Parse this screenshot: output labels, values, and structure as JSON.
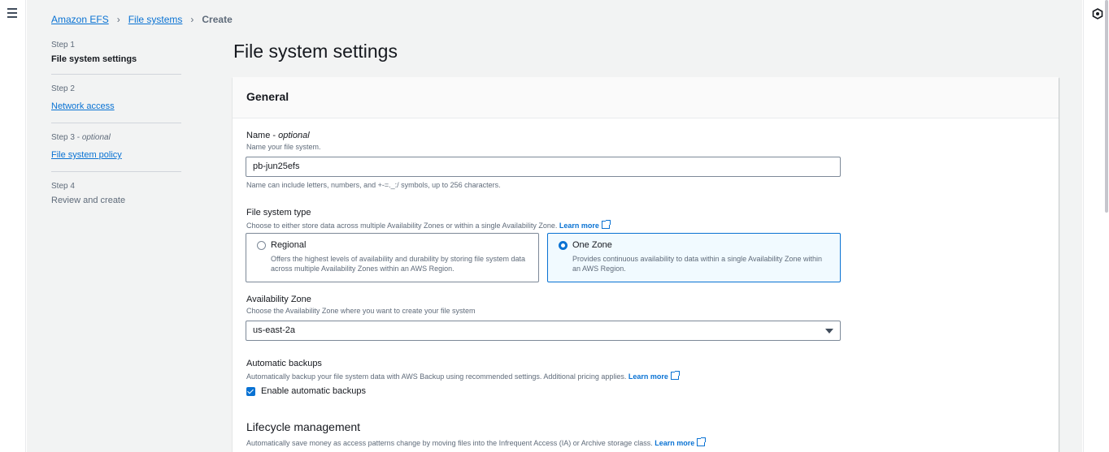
{
  "breadcrumb": {
    "items": [
      "Amazon EFS",
      "File systems"
    ],
    "current": "Create"
  },
  "steps": [
    {
      "number": "Step 1",
      "optional": "",
      "title": "File system settings"
    },
    {
      "number": "Step 2",
      "optional": "",
      "title": "Network access"
    },
    {
      "number": "Step 3",
      "optional": "optional",
      "title": "File system policy"
    },
    {
      "number": "Step 4",
      "optional": "",
      "title": "Review and create"
    }
  ],
  "page": {
    "title": "File system settings"
  },
  "general": {
    "header": "General",
    "name": {
      "label": "Name",
      "optional": "optional",
      "description": "Name your file system.",
      "value": "pb-jun25efs",
      "hint": "Name can include letters, numbers, and +-=._:/ symbols, up to 256 characters."
    },
    "fs_type": {
      "label": "File system type",
      "description": "Choose to either store data across multiple Availability Zones or within a single Availability Zone.",
      "learn_more": "Learn more",
      "options": [
        {
          "label": "Regional",
          "description": "Offers the highest levels of availability and durability by storing file system data across multiple Availability Zones within an AWS Region.",
          "selected": false
        },
        {
          "label": "One Zone",
          "description": "Provides continuous availability to data within a single Availability Zone within an AWS Region.",
          "selected": true
        }
      ]
    },
    "az": {
      "label": "Availability Zone",
      "description": "Choose the Availability Zone where you want to create your file system",
      "value": "us-east-2a"
    },
    "backups": {
      "label": "Automatic backups",
      "description": "Automatically backup your file system data with AWS Backup using recommended settings. Additional pricing applies.",
      "learn_more": "Learn more",
      "checkbox_label": "Enable automatic backups",
      "checked": true
    },
    "lifecycle": {
      "title": "Lifecycle management",
      "description": "Automatically save money as access patterns change by moving files into the Infrequent Access (IA) or Archive storage class.",
      "learn_more": "Learn more"
    }
  }
}
